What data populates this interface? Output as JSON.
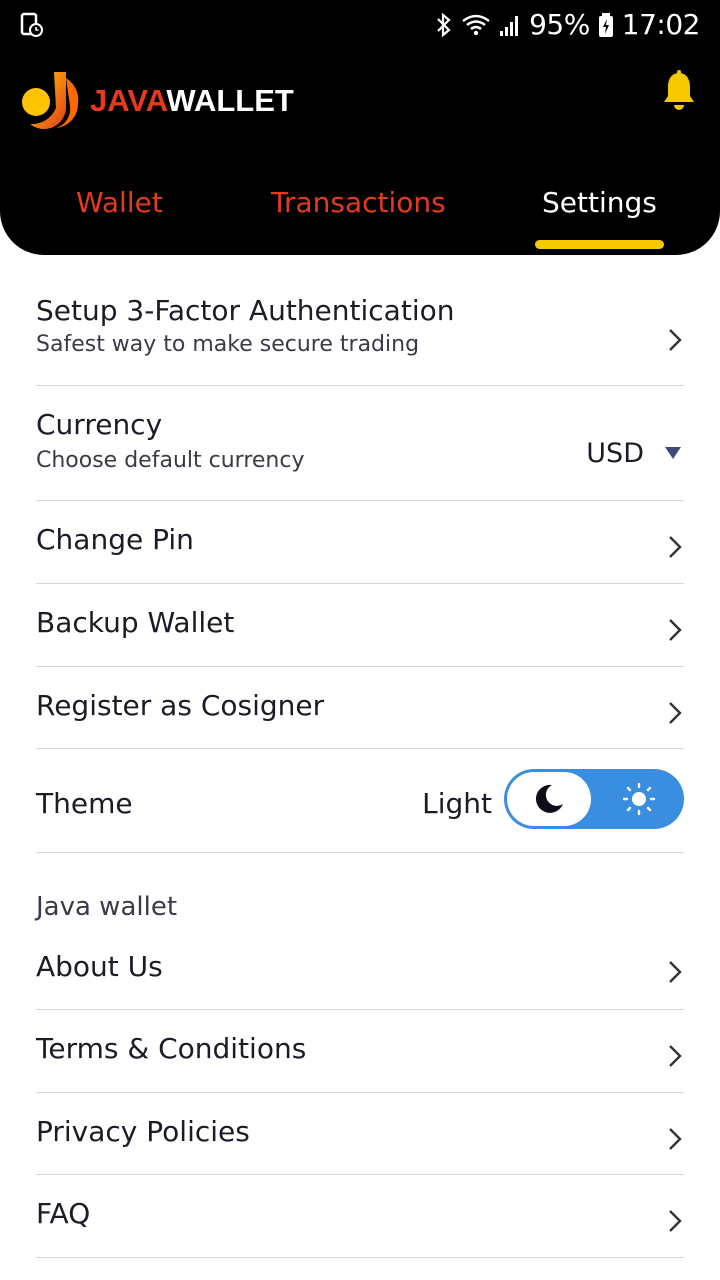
{
  "status_bar": {
    "battery_text": "95%",
    "time": "17:02"
  },
  "brand": {
    "java": "JAVA",
    "wallet": "WALLET"
  },
  "tabs": [
    {
      "label": "Wallet",
      "active": false
    },
    {
      "label": "Transactions",
      "active": false
    },
    {
      "label": "Settings",
      "active": true
    }
  ],
  "settings": {
    "three_factor": {
      "title": "Setup 3-Factor Authentication",
      "subtitle": "Safest way to make secure trading"
    },
    "currency": {
      "title": "Currency",
      "subtitle": "Choose default currency",
      "value": "USD"
    },
    "change_pin": {
      "title": "Change Pin"
    },
    "backup_wallet": {
      "title": "Backup Wallet"
    },
    "cosigner": {
      "title": "Register as Cosigner"
    },
    "theme": {
      "title": "Theme",
      "value": "Light"
    }
  },
  "about_section": {
    "label": "Java wallet",
    "items": [
      {
        "title": "About Us"
      },
      {
        "title": "Terms & Conditions"
      },
      {
        "title": "Privacy Policies"
      },
      {
        "title": "FAQ"
      }
    ]
  },
  "icons": {
    "bell": "bell-icon",
    "chevron": "chevron-right-icon",
    "caret": "caret-down-icon",
    "moon": "moon-icon",
    "sun": "sun-icon"
  },
  "colors": {
    "header_bg": "#000000",
    "brand_red": "#e53a1e",
    "accent_yellow": "#f6c800",
    "toggle_blue": "#3a8ee0",
    "caret_blue": "#3b4a78"
  }
}
